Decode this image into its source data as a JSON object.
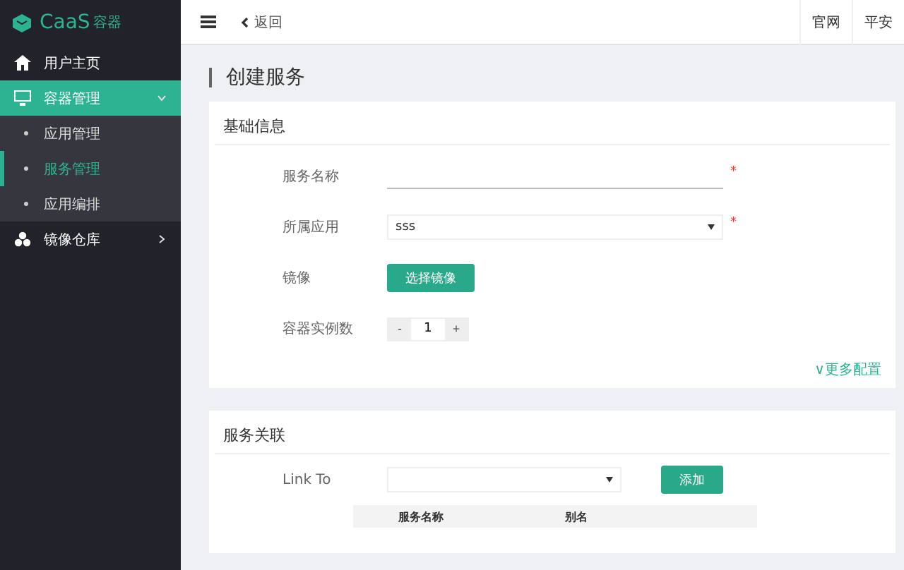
{
  "sidebar": {
    "logo": "CaaS",
    "logo_suffix": "容器",
    "items": [
      {
        "label": "用户主页",
        "selected": false
      },
      {
        "label": "容器管理",
        "selected": true,
        "expanded": true,
        "children": [
          {
            "label": "应用管理",
            "selected": false
          },
          {
            "label": "服务管理",
            "selected": true
          },
          {
            "label": "应用编排",
            "selected": false
          }
        ]
      },
      {
        "label": "镜像仓库",
        "selected": false,
        "expanded": false
      }
    ]
  },
  "header": {
    "back": "返回",
    "links": [
      "官网",
      "平安"
    ]
  },
  "page_title": "创建服务",
  "basic": {
    "title": "基础信息",
    "fields": [
      {
        "kind": "text",
        "label": "服务名称",
        "required_mark": "*"
      },
      {
        "kind": "select",
        "label": "所属应用",
        "value": "sss",
        "required_mark": "*"
      },
      {
        "kind": "button",
        "label": "镜像",
        "button": "选择镜像"
      },
      {
        "kind": "stepper",
        "label": "容器实例数",
        "minus": "-",
        "value": "1",
        "plus": "+"
      }
    ],
    "more": "∨更多配置"
  },
  "link": {
    "title": "服务关联",
    "label": "Link To",
    "button": "添加",
    "columns": [
      "服务名称",
      "别名"
    ]
  }
}
